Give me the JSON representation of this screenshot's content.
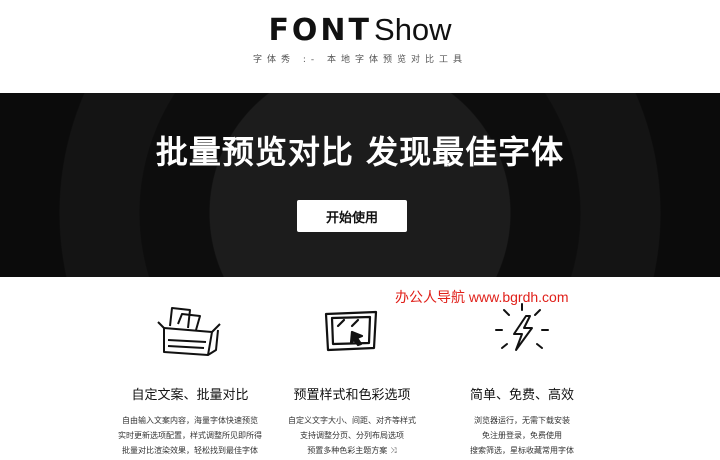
{
  "header": {
    "logo_main": "FONT",
    "logo_sub": "Show",
    "tagline": "字体秀 :- 本地字体预览对比工具"
  },
  "hero": {
    "title": "批量预览对比 发现最佳字体",
    "button_label": "开始使用"
  },
  "watermark": "办公人导航 www.bgrdh.com",
  "features": [
    {
      "icon": "box-icon",
      "title": "自定文案、批量对比",
      "lines": [
        "自由输入文案内容，海量字体快速预览",
        "实时更新选项配置，样式调整所见即所得",
        "批量对比渲染效果，轻松找到最佳字体"
      ]
    },
    {
      "icon": "screen-cursor-icon",
      "title": "预置样式和色彩选项",
      "lines": [
        "自定义文字大小、间距、对齐等样式",
        "支持调整分页、分列布局选项",
        "预置多种色彩主题方案"
      ],
      "extra_icon": "shuffle-icon"
    },
    {
      "icon": "lightning-icon",
      "title": "简单、免费、高效",
      "lines": [
        "浏览器运行，无需下载安装",
        "免注册登录，免费使用",
        "搜索筛选，星标收藏常用字体"
      ]
    }
  ]
}
